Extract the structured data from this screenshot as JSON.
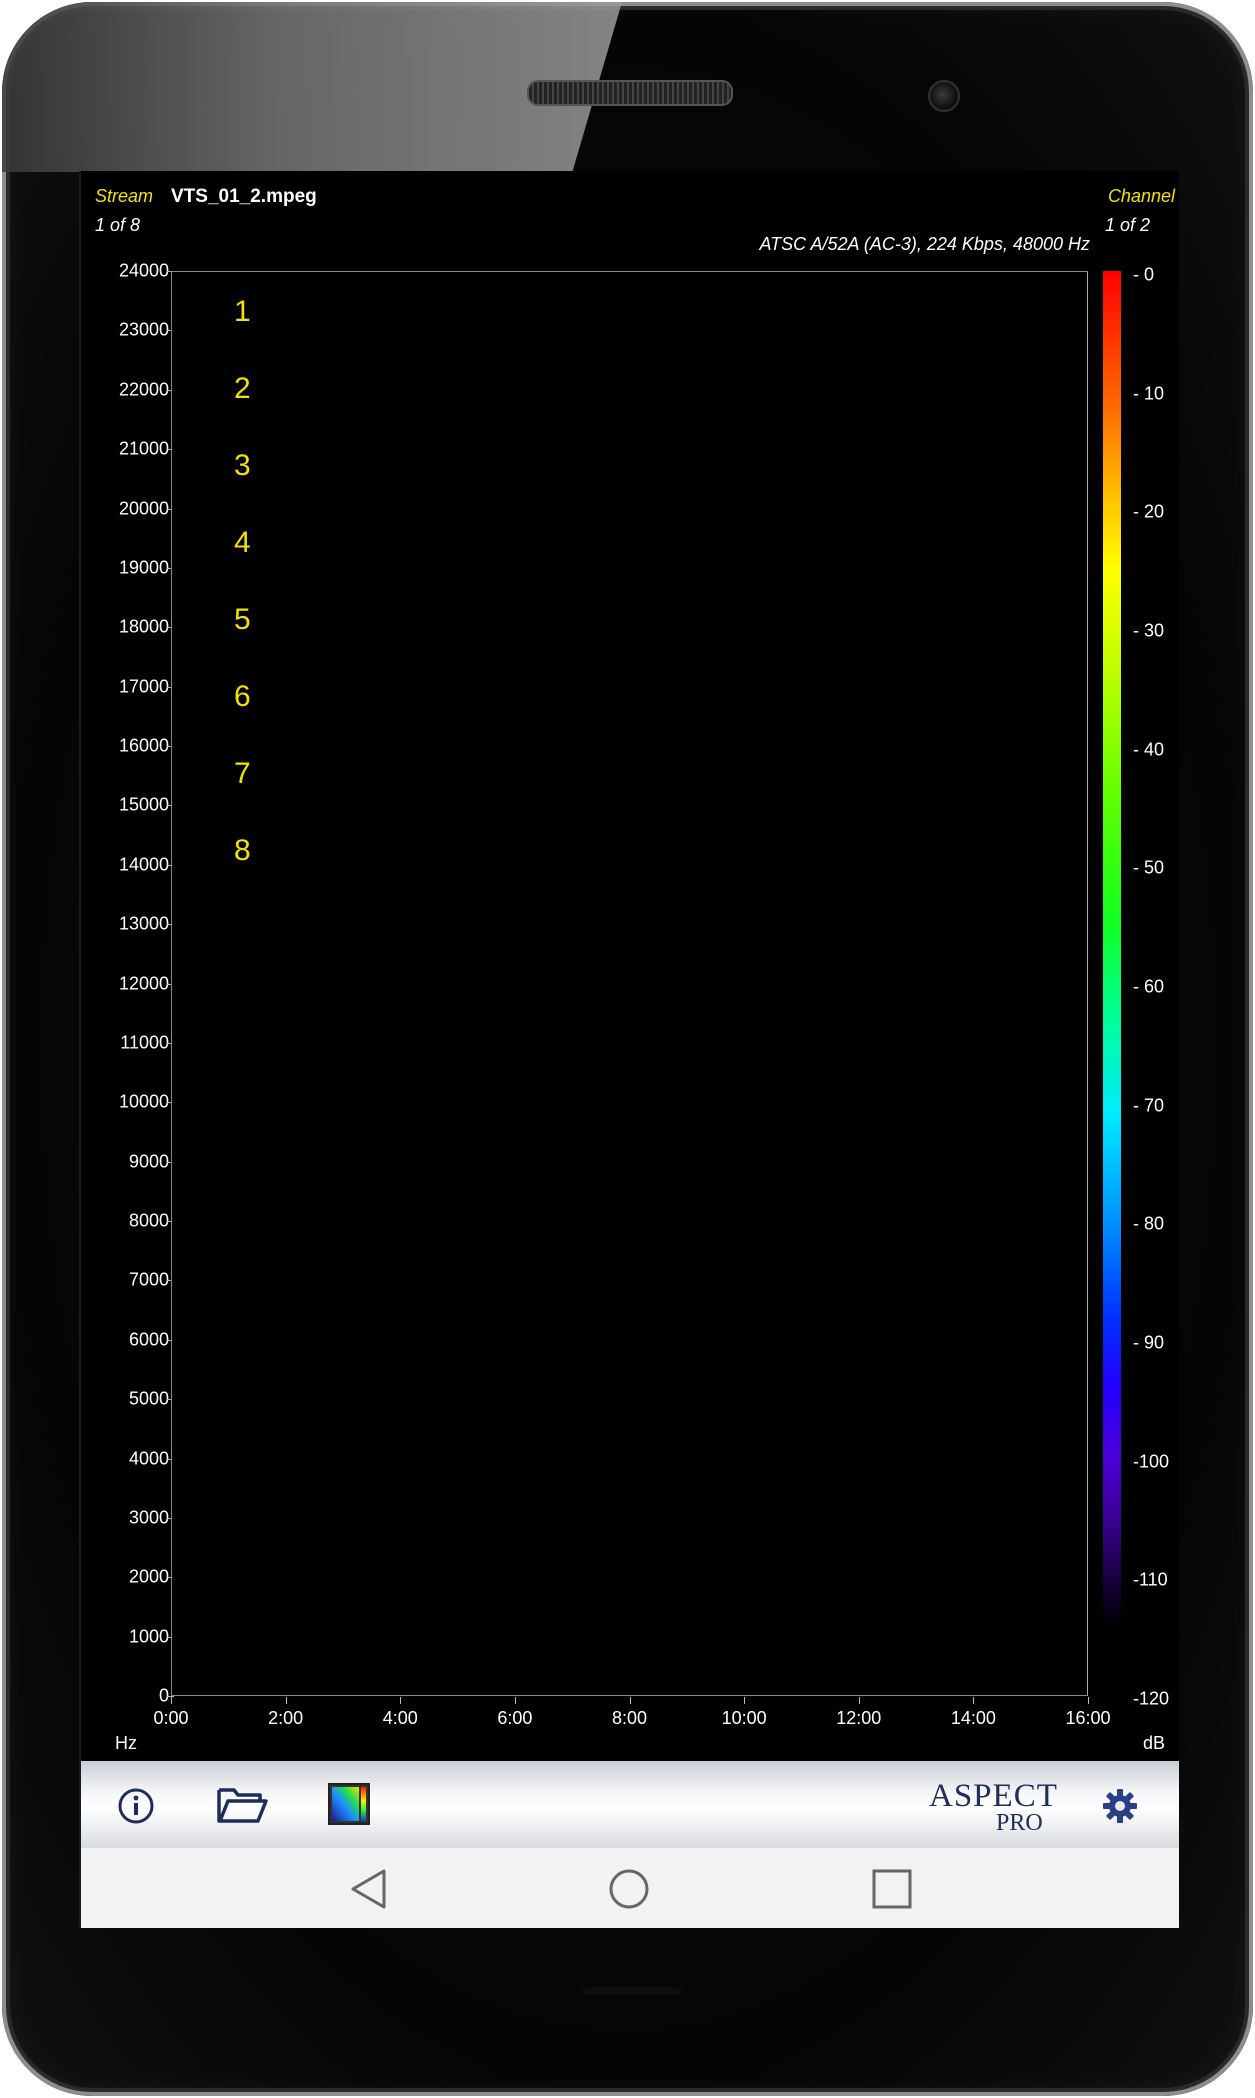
{
  "header": {
    "stream_label": "Stream",
    "stream_file": "VTS_01_2.mpeg",
    "stream_index": "1 of 8",
    "channel_label": "Channel",
    "channel_index": "1 of 2",
    "codec_info": "ATSC A/52A (AC-3), 224 Kbps, 48000 Hz"
  },
  "stream_list": [
    "1",
    "2",
    "3",
    "4",
    "5",
    "6",
    "7",
    "8"
  ],
  "units": {
    "y": "Hz",
    "scale": "dB"
  },
  "chart_data": {
    "type": "heatmap",
    "x": {
      "ticks": [
        "0:00",
        "2:00",
        "4:00",
        "6:00",
        "8:00",
        "10:00",
        "12:00",
        "14:00",
        "16:00"
      ],
      "range": [
        "0:00",
        "16:00"
      ]
    },
    "y": {
      "ticks": [
        "0",
        "1000",
        "2000",
        "3000",
        "4000",
        "5000",
        "6000",
        "7000",
        "8000",
        "9000",
        "10000",
        "11000",
        "12000",
        "13000",
        "14000",
        "15000",
        "16000",
        "17000",
        "18000",
        "19000",
        "20000",
        "21000",
        "22000",
        "23000",
        "24000"
      ],
      "range": [
        0,
        24000
      ]
    },
    "colorscale": {
      "ticks": [
        "- 0",
        "- 10",
        "- 20",
        "- 30",
        "- 40",
        "- 50",
        "- 60",
        "- 70",
        "- 80",
        "- 90",
        "-100",
        "-110",
        "-120"
      ],
      "range": [
        -120,
        0
      ],
      "colors": [
        "#ff0000",
        "#ffff00",
        "#00ff00",
        "#00eaff",
        "#0030ff",
        "#3a0090",
        "#000000"
      ]
    },
    "values": []
  },
  "toolbar": {
    "info_icon": "info-icon",
    "open_icon": "folder-open-icon",
    "spectrum_icon": "spectrogram-icon",
    "logo_main": "ASPECT",
    "logo_sub": "PRO",
    "settings_icon": "gear-icon"
  },
  "navbar": {
    "back": "back-triangle-icon",
    "home": "home-circle-icon",
    "recents": "recents-square-icon"
  },
  "colors": {
    "accent_yellow": "#f1e200",
    "logo_navy": "#1f2d5a",
    "background": "#000000"
  }
}
